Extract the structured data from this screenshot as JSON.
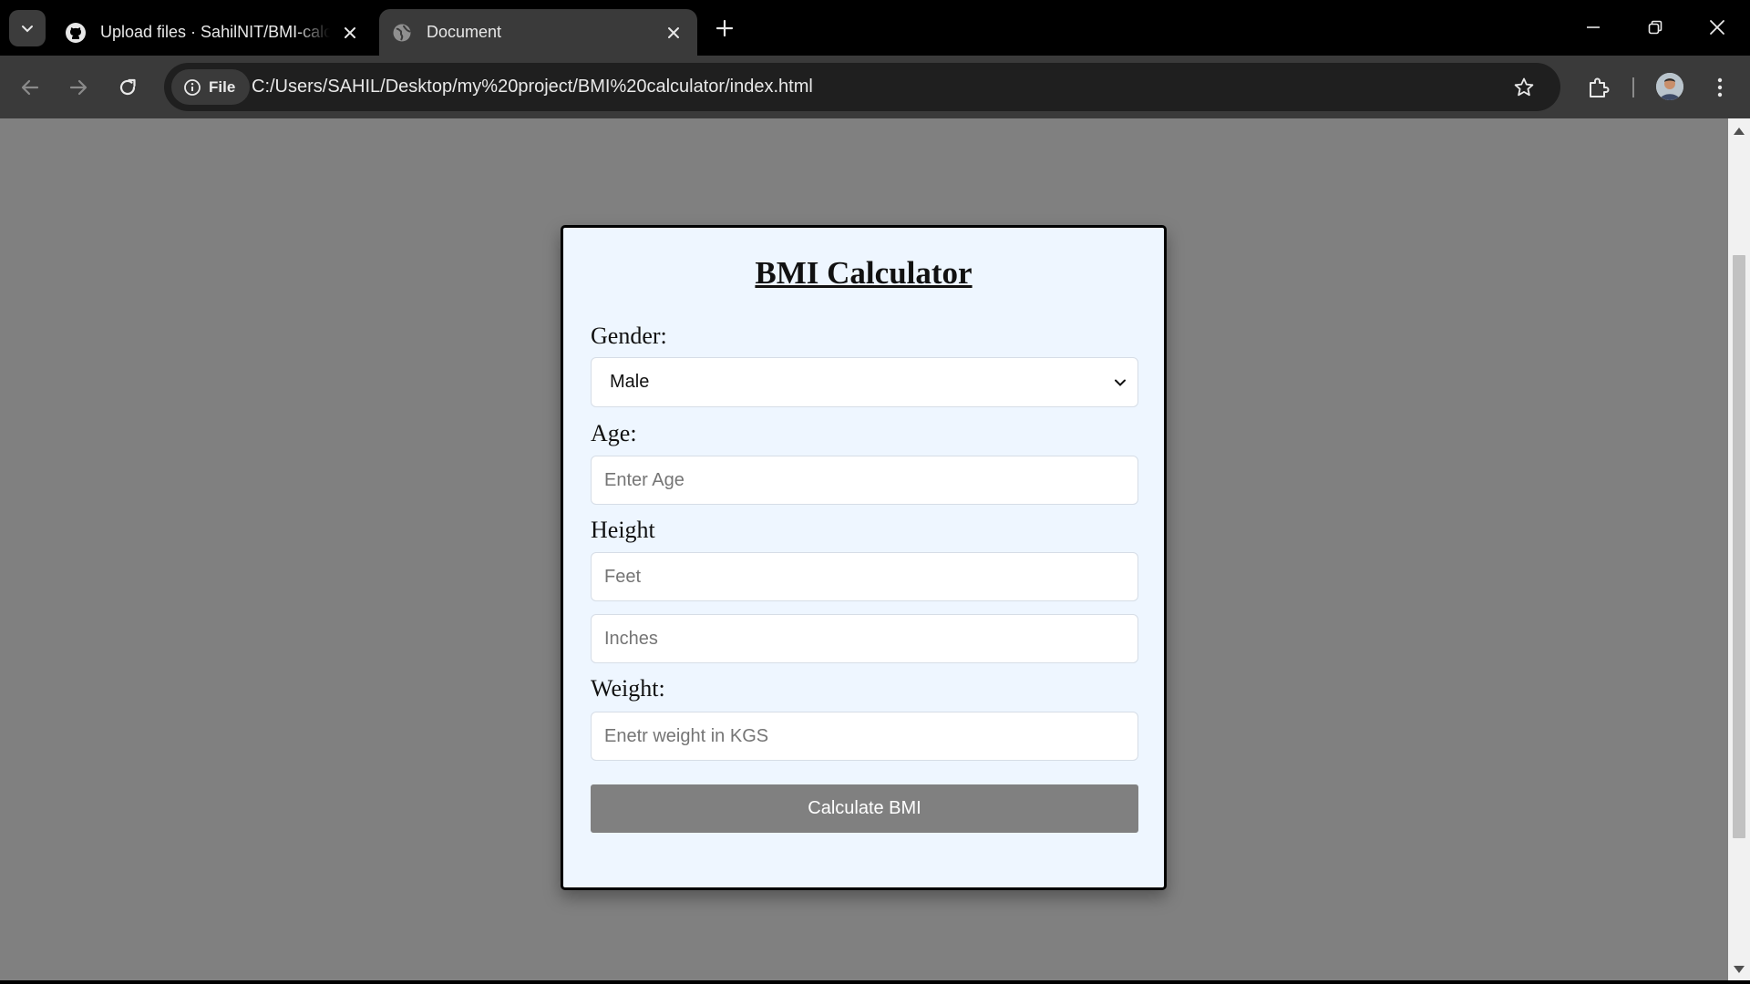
{
  "browser": {
    "tabs": [
      {
        "title": "Upload files · SahilNIT/BMI-calculator",
        "favicon": "github-icon",
        "active": false
      },
      {
        "title": "Document",
        "favicon": "globe-icon",
        "active": true
      }
    ],
    "address_bar": {
      "scheme_chip": "File",
      "url": "C:/Users/SAHIL/Desktop/my%20project/BMI%20calculator/index.html"
    }
  },
  "page": {
    "title": "BMI Calculator",
    "gender": {
      "label": "Gender:",
      "selected": "Male"
    },
    "age": {
      "label": "Age:",
      "placeholder": "Enter Age"
    },
    "height": {
      "label": "Height",
      "feet_placeholder": "Feet",
      "inches_placeholder": "Inches"
    },
    "weight": {
      "label": "Weight:",
      "placeholder": "Enetr weight in KGS"
    },
    "calculate_button": "Calculate BMI"
  },
  "colors": {
    "page_background": "#808080",
    "card_background": "#eef6ff",
    "button_background": "#808080",
    "chrome_dark": "#000000",
    "toolbar": "#3a3a3a"
  }
}
